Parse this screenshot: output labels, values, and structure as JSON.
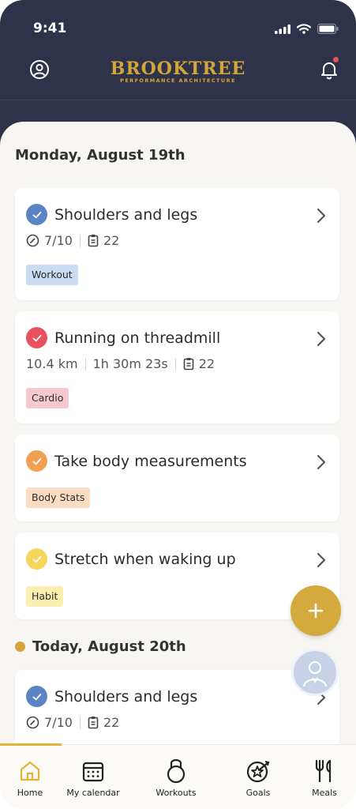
{
  "status": {
    "time": "9:41"
  },
  "brand": {
    "name": "BROOKTREE",
    "tagline": "PERFORMANCE ARCHITECTURE"
  },
  "colors": {
    "header": "#2f3349",
    "accent": "#d4a53a",
    "workout": "#5b84c4",
    "cardio": "#e8515e",
    "body_stats": "#f0a050",
    "habit": "#f5d65a"
  },
  "sections": [
    {
      "date": "Monday, August 19th",
      "items": [
        {
          "title": "Shoulders and legs",
          "meta": [
            "7/10",
            "22"
          ],
          "tag": "Workout"
        },
        {
          "title": "Running on threadmill",
          "meta": [
            "10.4 km",
            "1h 30m 23s",
            "22"
          ],
          "tag": "Cardio"
        },
        {
          "title": "Take body measurements",
          "tag": "Body Stats"
        },
        {
          "title": "Stretch when waking up",
          "tag": "Habit"
        }
      ]
    },
    {
      "date": "Today, August 20th",
      "items": [
        {
          "title": "Shoulders and legs",
          "meta": [
            "7/10",
            "22"
          ]
        }
      ]
    }
  ],
  "nav": {
    "home": "Home",
    "calendar": "My calendar",
    "workouts": "Workouts",
    "goals": "Goals",
    "meals": "Meals"
  }
}
